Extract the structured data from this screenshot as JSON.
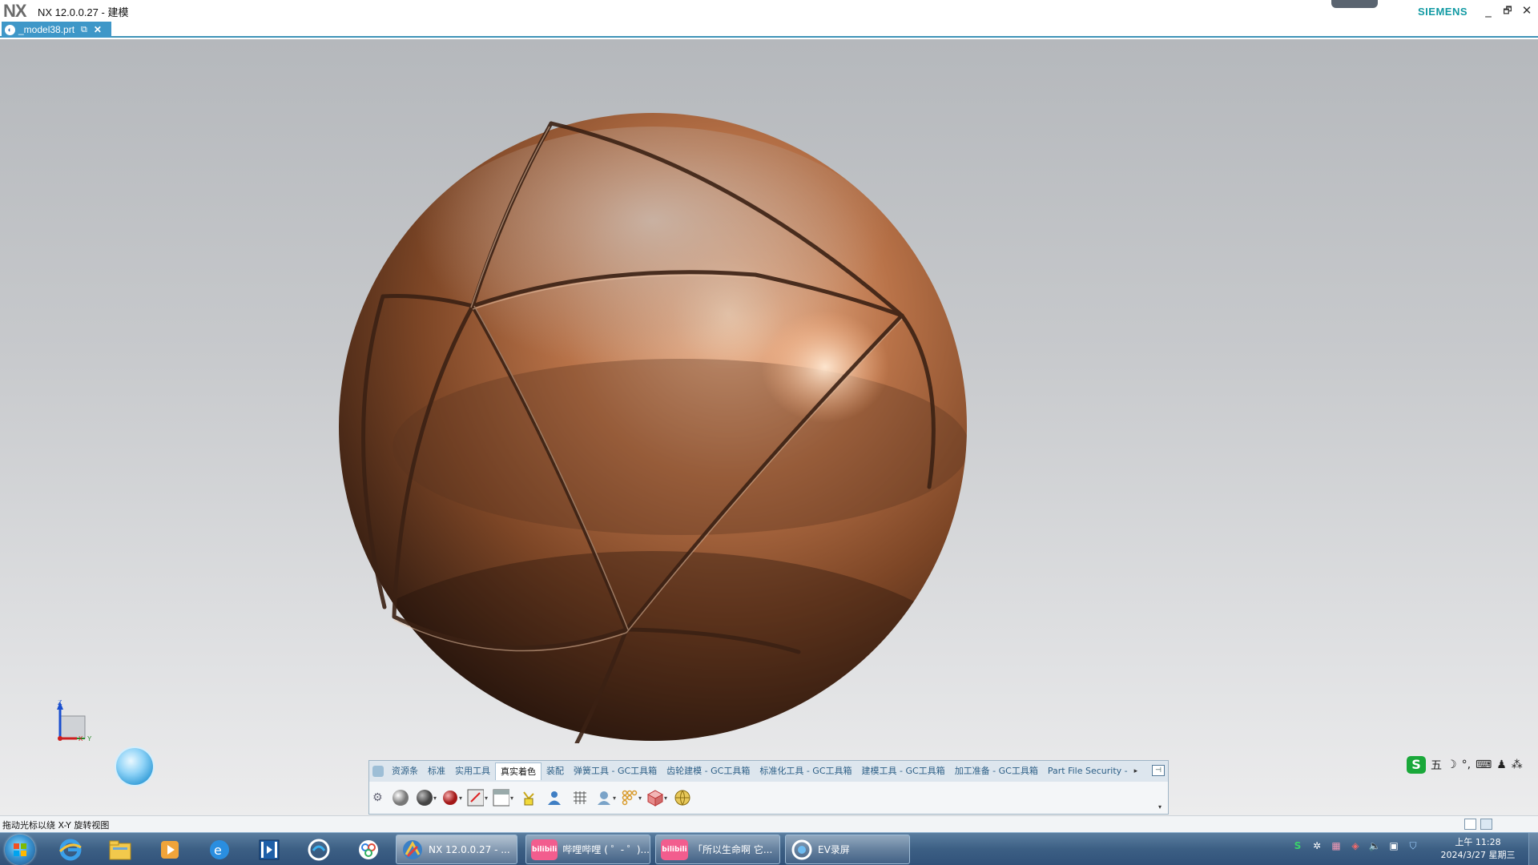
{
  "window": {
    "logo": "NX",
    "title": "NX 12.0.0.27 - 建模",
    "brand": "SIEMENS",
    "minimize": "_",
    "restore": "🗗",
    "close": "✕"
  },
  "document_tab": {
    "label": "_model38.prt",
    "icon": "part-file-icon",
    "close": "✕"
  },
  "viewport": {
    "model": "copper-sphere-with-seams",
    "triad": {
      "z": "Z",
      "y": "Y",
      "x": "X"
    },
    "colors": {
      "sphere": "#b06a3c",
      "background_top": "#b5b8bc",
      "background_bottom": "#ececed"
    }
  },
  "ribbon": {
    "tabs": [
      {
        "label": "资源条",
        "active": false
      },
      {
        "label": "标准",
        "active": false
      },
      {
        "label": "实用工具",
        "active": false
      },
      {
        "label": "真实着色",
        "active": true
      },
      {
        "label": "装配",
        "active": false
      },
      {
        "label": "弹簧工具 - GC工具箱",
        "active": false
      },
      {
        "label": "齿轮建模 - GC工具箱",
        "active": false
      },
      {
        "label": "标准化工具 - GC工具箱",
        "active": false
      },
      {
        "label": "建模工具 - GC工具箱",
        "active": false
      },
      {
        "label": "加工准备 - GC工具箱",
        "active": false
      },
      {
        "label": "Part File Security -",
        "active": false
      }
    ],
    "tools": [
      "shaded-sphere-icon",
      "material-sphere-icon",
      "red-sphere-icon",
      "background-icon",
      "floor-icon",
      "light-icon",
      "person-icon",
      "grid-icon",
      "camera-icon",
      "array-icon",
      "cube-icon",
      "globe-icon"
    ]
  },
  "ime": {
    "logo": "S",
    "mode": "五",
    "moon": "☽",
    "punct": "°,",
    "keyboard": "⌨",
    "user": "♟",
    "grid": "⁂"
  },
  "status": {
    "text": "拖动光标以绕 X-Y 旋转视图"
  },
  "taskbar": {
    "tasks": [
      {
        "label": "NX 12.0.0.27 - ...",
        "active": true
      },
      {
        "label": "哔哩哔哩 ( ゜- ゜)...",
        "active": false
      },
      {
        "label": "「所以生命啊 它...",
        "active": false
      },
      {
        "label": "EV录屏",
        "active": false
      }
    ],
    "bili_logo": "bilibili",
    "clock": {
      "time": "上午 11:28",
      "date": "2024/3/27 星期三"
    }
  }
}
